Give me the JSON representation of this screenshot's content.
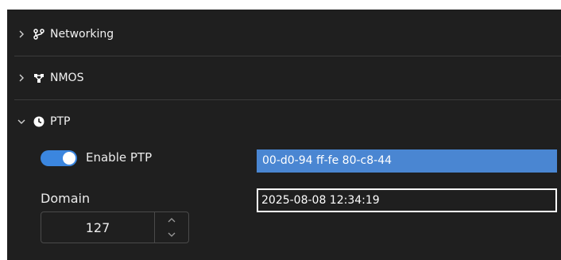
{
  "sections": {
    "networking": {
      "label": "Networking",
      "icon": "git-branch-icon",
      "expanded": false
    },
    "nmos": {
      "label": "NMOS",
      "icon": "network-nodes-icon",
      "expanded": false
    },
    "ptp": {
      "label": "PTP",
      "icon": "clock-icon",
      "expanded": true
    }
  },
  "ptp": {
    "enable_label": "Enable PTP",
    "enabled": true,
    "domain_label": "Domain",
    "domain_value": "127",
    "clock_id": "00-d0-94 ff-fe 80-c8-44",
    "time": "2025-08-08 12:34:19"
  },
  "colors": {
    "panel": "#1f1f1f",
    "accent": "#3b86df",
    "selection": "#4a86d2"
  }
}
